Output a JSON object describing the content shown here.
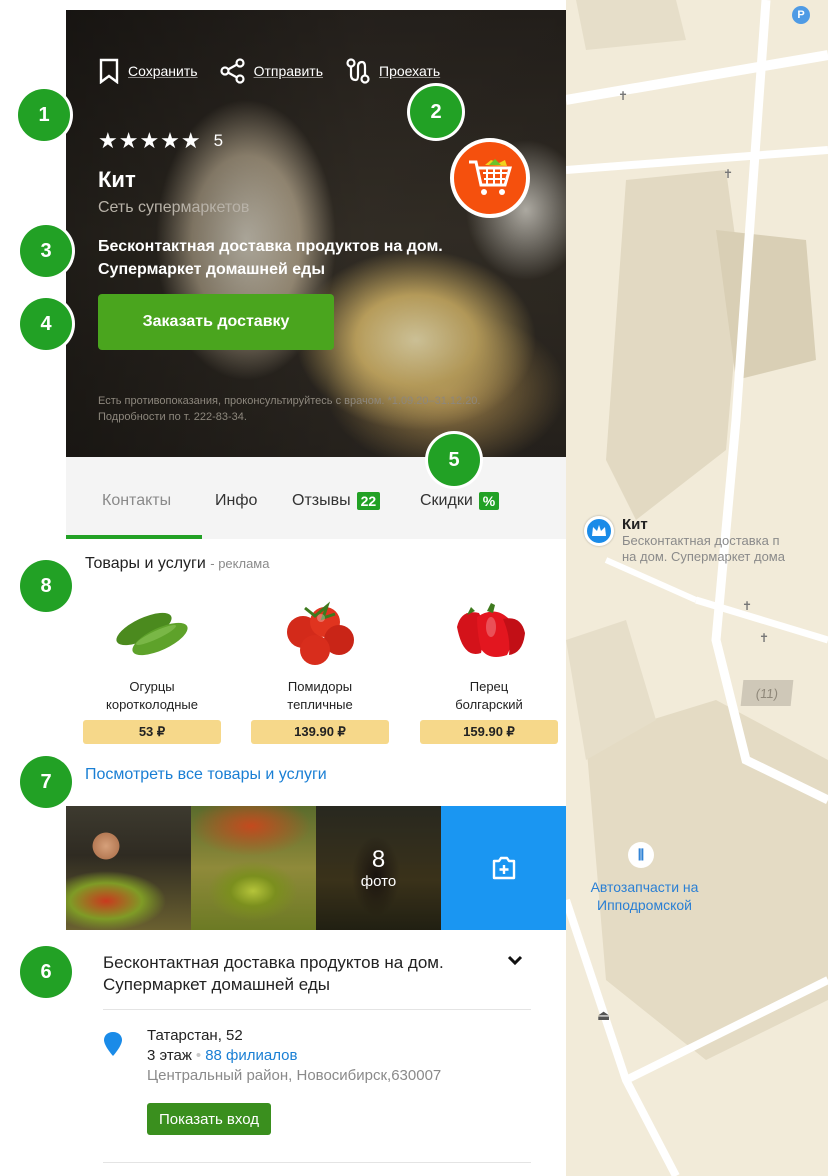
{
  "hero": {
    "actions": [
      {
        "label": "Сохранить",
        "icon": "bookmark-icon"
      },
      {
        "label": "Отправить",
        "icon": "share-icon"
      },
      {
        "label": "Проехать",
        "icon": "route-icon"
      }
    ],
    "rating_stars": "★★★★★",
    "rating_value": "5",
    "title": "Кит",
    "subtitle": "Сеть супермаркетов",
    "promo": "Бесконтактная доставка продуктов на дом. Супермаркет домашней еды",
    "order_button": "Заказать доставку",
    "disclaimer": "Есть противопоказания, проконсультируйтесь с врачом. *1.09.20–31.12.20. Подробности по т. 222-83-34.",
    "logo_color": "#f5500d"
  },
  "tabs": [
    {
      "label": "Контакты",
      "active": true
    },
    {
      "label": "Инфо"
    },
    {
      "label": "Отзывы",
      "badge": "22"
    },
    {
      "label": "Скидки",
      "badge": "%"
    }
  ],
  "products": {
    "title": "Товары и услуги",
    "ad_label": "- реклама",
    "items": [
      {
        "name_line1": "Огурцы",
        "name_line2": "коротколодные",
        "price": "53 ₽",
        "icon": "cucumber-icon"
      },
      {
        "name_line1": "Помидоры",
        "name_line2": "тепличные",
        "price": "139.90 ₽",
        "icon": "tomato-icon"
      },
      {
        "name_line1": "Перец",
        "name_line2": "болгарский",
        "price": "159.90 ₽",
        "icon": "pepper-icon"
      }
    ],
    "see_all": "Посмотреть все товары и услуги"
  },
  "photos": {
    "count": "8",
    "count_label": "фото"
  },
  "description": "Бесконтактная доставка продуктов на дом. Супермаркет домашней еды",
  "address": {
    "street": "Татарстан, 52",
    "floor": "3 этаж",
    "branches": "88 филиалов",
    "district": "Центральный район, Новосибирск,630007",
    "show_entrance": "Показать вход"
  },
  "map": {
    "poi_title": "Кит",
    "poi_sub_line1": "Бесконтактная доставка п",
    "poi_sub_line2": "на дом. Супермаркет дома",
    "auto_line1": "Автозапчасти на",
    "auto_line2": "Ипподромской",
    "house_number": "(11)",
    "parking": "P"
  },
  "callouts": [
    "1",
    "2",
    "3",
    "4",
    "5",
    "6",
    "7",
    "8"
  ],
  "colors": {
    "accent_green": "#22a125",
    "button_green": "#4aa51e",
    "link_blue": "#1a7fd4",
    "price_bg": "#f6d88a",
    "add_photo_blue": "#1a96f2"
  }
}
